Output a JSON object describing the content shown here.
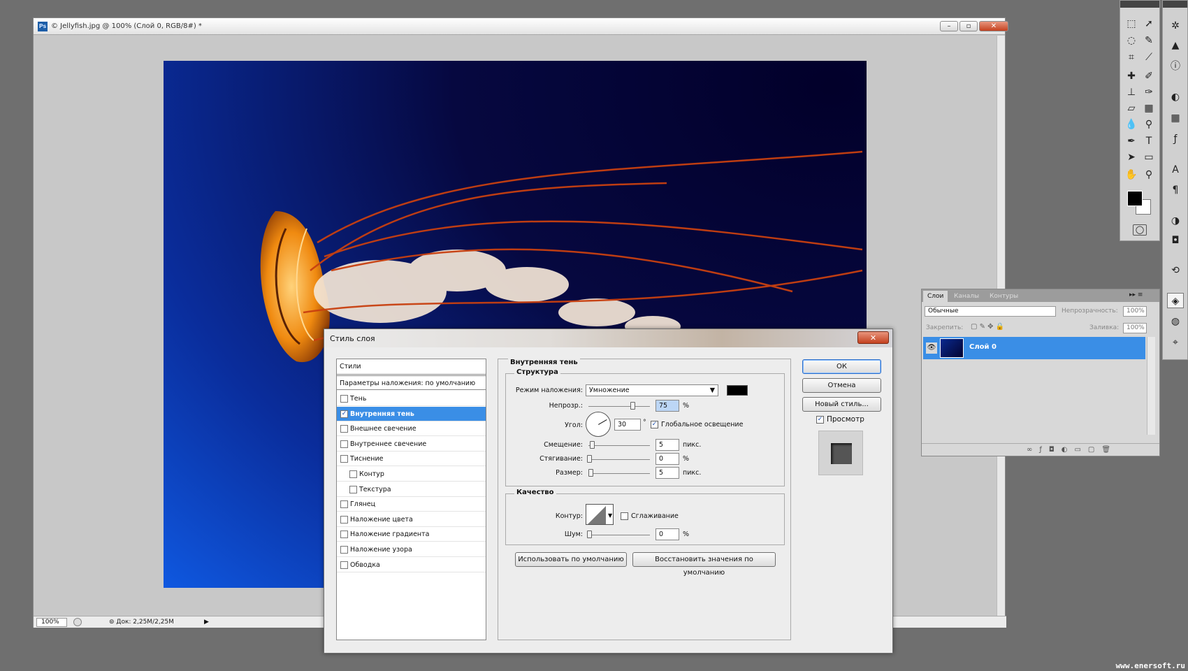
{
  "document": {
    "title": "© Jellyfish.jpg @ 100% (Слой 0, RGB/8#) *",
    "app_icon": "Ps",
    "zoom": "100%",
    "doc_info": "Док: 2,25M/2,25M"
  },
  "layers_panel": {
    "tabs": [
      "Слои",
      "Каналы",
      "Контуры"
    ],
    "blend_mode": "Обычные",
    "opacity_label": "Непрозрачность:",
    "opacity_value": "100%",
    "lock_label": "Закрепить:",
    "fill_label": "Заливка:",
    "fill_value": "100%",
    "layer_name": "Слой 0"
  },
  "dialog": {
    "title": "Стиль слоя",
    "styles_header": "Стили",
    "blend_options": "Параметры наложения: по умолчанию",
    "styles": [
      {
        "label": "Тень",
        "checked": false,
        "indent": false
      },
      {
        "label": "Внутренняя тень",
        "checked": true,
        "indent": false,
        "selected": true
      },
      {
        "label": "Внешнее свечение",
        "checked": false,
        "indent": false
      },
      {
        "label": "Внутреннее свечение",
        "checked": false,
        "indent": false
      },
      {
        "label": "Тиснение",
        "checked": false,
        "indent": false
      },
      {
        "label": "Контур",
        "checked": false,
        "indent": true
      },
      {
        "label": "Текстура",
        "checked": false,
        "indent": true
      },
      {
        "label": "Глянец",
        "checked": false,
        "indent": false
      },
      {
        "label": "Наложение цвета",
        "checked": false,
        "indent": false
      },
      {
        "label": "Наложение градиента",
        "checked": false,
        "indent": false
      },
      {
        "label": "Наложение узора",
        "checked": false,
        "indent": false
      },
      {
        "label": "Обводка",
        "checked": false,
        "indent": false
      }
    ],
    "section_title": "Внутренняя тень",
    "structure": {
      "title": "Структура",
      "blend_label": "Режим наложения:",
      "blend_value": "Умножение",
      "shadow_color": "#000000",
      "opacity_label": "Непрозр.:",
      "opacity_value": "75",
      "opacity_level": 75,
      "opacity_unit": "%",
      "angle_label": "Угол:",
      "angle_value": "30",
      "angle_unit": "°",
      "global_light_label": "Глобальное освещение",
      "global_light_checked": true,
      "distance_label": "Смещение:",
      "distance_value": "5",
      "distance_unit": "пикс.",
      "choke_label": "Стягивание:",
      "choke_value": "0",
      "choke_unit": "%",
      "size_label": "Размер:",
      "size_value": "5",
      "size_unit": "пикс."
    },
    "quality": {
      "title": "Качество",
      "contour_label": "Контур:",
      "antialias_label": "Сглаживание",
      "noise_label": "Шум:",
      "noise_value": "0",
      "noise_unit": "%"
    },
    "make_default": "Использовать по умолчанию",
    "reset_default": "Восстановить значения по умолчанию",
    "ok": "ОК",
    "cancel": "Отмена",
    "new_style": "Новый стиль...",
    "preview_label": "Просмотр",
    "preview_checked": true
  },
  "watermark": "www.enersoft.ru",
  "colors": {
    "accent": "#3a8ee6",
    "close": "#c4411f",
    "foreground": "#000000",
    "background": "#ffffff"
  }
}
